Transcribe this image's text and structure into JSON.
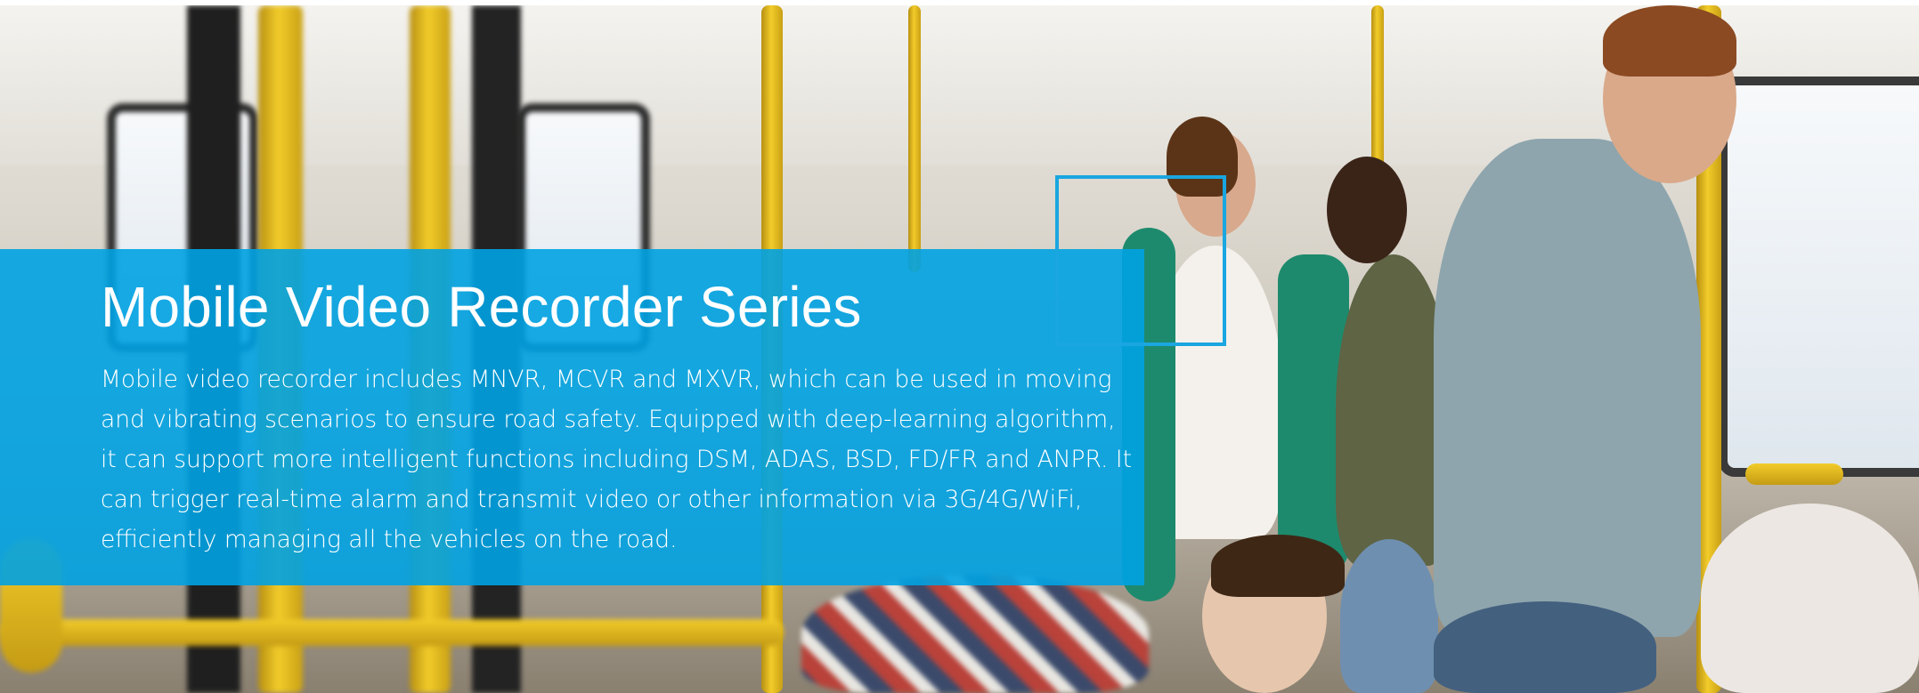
{
  "banner": {
    "title": "Mobile Video Recorder Series",
    "description": "Mobile video recorder includes MNVR, MCVR and MXVR, which can be used in moving and vibrating scenarios to ensure road safety. Equipped with deep-learning algorithm, it can support more intelligent functions including DSM, ADAS, BSD, FD/FR and ANPR. It can trigger real-time alarm and transmit video or other information via 3G/4G/WiFi, efficiently managing all the vehicles on the road.",
    "image": "bus-passengers-photo",
    "colors": {
      "panel": "#00a2e2",
      "text": "#ffffff",
      "accent": "#1aa6e0",
      "poles": "#f2cc2a"
    }
  }
}
